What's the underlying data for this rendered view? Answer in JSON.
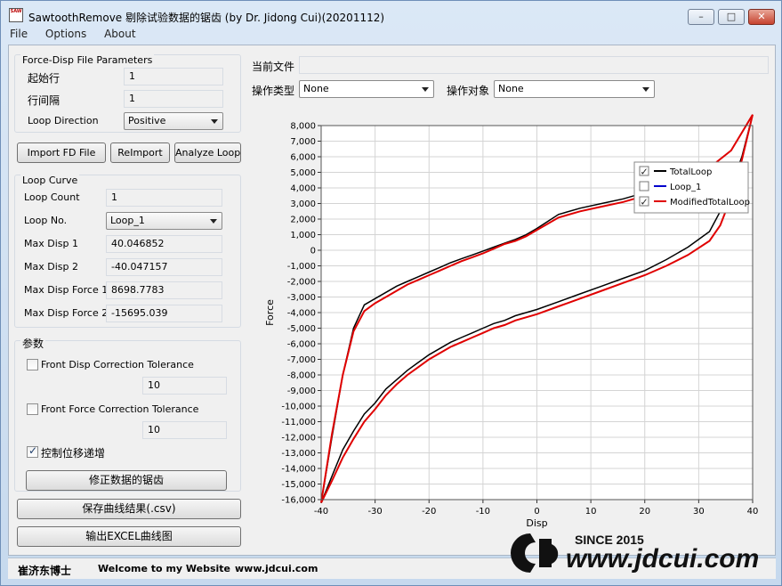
{
  "window": {
    "title": "SawtoothRemove 剔除试验数据的锯齿 (by Dr. Jidong Cui)(20201112)",
    "icon_text": "SAW",
    "minimize_glyph": "–",
    "maximize_glyph": "□",
    "close_glyph": "✕"
  },
  "menu": [
    "File",
    "Options",
    "About"
  ],
  "params": {
    "title": "Force-Disp File Parameters",
    "start_row_label": "起始行",
    "start_row_value": "1",
    "row_interval_label": "行间隔",
    "row_interval_value": "1",
    "loop_direction_label": "Loop Direction",
    "loop_direction_value": "Positive"
  },
  "buttons": {
    "import": "Import FD File",
    "reimport": "ReImport",
    "analyze": "Analyze Loop",
    "fix": "修正数据的锯齿",
    "save": "保存曲线结果(.csv)",
    "export": "输出EXCEL曲线图"
  },
  "loop_curve": {
    "title": "Loop Curve",
    "rows": [
      {
        "label": "Loop Count",
        "value": "1"
      },
      {
        "label": "Loop No.",
        "value": "Loop_1"
      },
      {
        "label": "Max Disp 1",
        "value": "40.046852"
      },
      {
        "label": "Max Disp 2",
        "value": "-40.047157"
      },
      {
        "label": "Max Disp Force 1",
        "value": "8698.7783"
      },
      {
        "label": "Max Disp Force 2",
        "value": "-15695.039"
      }
    ]
  },
  "settings": {
    "title": "参数",
    "front_disp_label": "Front Disp Correction Tolerance",
    "front_disp_value": "10",
    "front_force_label": "Front Force Correction Tolerance",
    "front_force_value": "10",
    "control_disp_label": "控制位移递增"
  },
  "file": {
    "current_file_label": "当前文件",
    "current_file_value": "",
    "op_type_label": "操作类型",
    "op_type_value": "None",
    "op_target_label": "操作对象",
    "op_target_value": "None"
  },
  "status": {
    "author": "崔济东博士",
    "welcome": "Welcome to my Website",
    "site": "www.jdcui.com"
  },
  "watermark": {
    "since": "SINCE 2015",
    "url": "www.jdcui.com"
  },
  "colors": {
    "total_loop": "#000000",
    "loop_1": "#0000cc",
    "modified": "#e00000"
  },
  "chart_data": {
    "type": "line",
    "xlabel": "Disp",
    "ylabel": "Force",
    "xlim": [
      -40,
      40
    ],
    "ylim": [
      -16000,
      8000
    ],
    "xticks": [
      -40,
      -30,
      -20,
      -10,
      0,
      10,
      20,
      30,
      40
    ],
    "yticks": [
      8000,
      7000,
      6000,
      5000,
      4000,
      3000,
      2000,
      1000,
      0,
      -1000,
      -2000,
      -3000,
      -4000,
      -5000,
      -6000,
      -7000,
      -8000,
      -9000,
      -10000,
      -11000,
      -12000,
      -13000,
      -14000,
      -15000,
      -16000
    ],
    "grid": true,
    "legend_position": "top-right",
    "series": [
      {
        "name": "TotalLoop",
        "checked": true,
        "x": [
          -40,
          -38,
          -36,
          -34,
          -32,
          -30,
          -28,
          -26,
          -24,
          -22,
          -20,
          -18,
          -16,
          -14,
          -12,
          -10,
          -8,
          -6,
          -4,
          -2,
          0,
          0,
          4,
          8,
          12,
          16,
          20,
          24,
          28,
          32,
          34,
          36,
          38,
          40,
          40,
          36,
          32,
          28,
          24,
          20,
          16,
          12,
          8,
          4,
          0,
          -2,
          -4,
          -6,
          -8,
          -10,
          -12,
          -14,
          -16,
          -18,
          -20,
          -22,
          -24,
          -26,
          -28,
          -30,
          -32,
          -34,
          -36,
          -38,
          -40
        ],
        "y": [
          -16200,
          -14500,
          -12800,
          -11600,
          -10500,
          -9800,
          -8900,
          -8300,
          -7700,
          -7200,
          -6700,
          -6300,
          -5900,
          -5600,
          -5300,
          -5000,
          -4700,
          -4500,
          -4200,
          -4000,
          -3800,
          -3800,
          -3300,
          -2800,
          -2300,
          -1800,
          -1300,
          -600,
          200,
          1200,
          2500,
          4100,
          6000,
          8700,
          8700,
          6400,
          5300,
          4600,
          4100,
          3700,
          3300,
          3000,
          2700,
          2300,
          1400,
          1000,
          700,
          450,
          200,
          -50,
          -300,
          -550,
          -800,
          -1100,
          -1400,
          -1700,
          -2000,
          -2300,
          -2700,
          -3100,
          -3500,
          -5000,
          -8000,
          -12000,
          -16200
        ]
      },
      {
        "name": "Loop_1",
        "checked": false,
        "x": [],
        "y": []
      },
      {
        "name": "ModifiedTotalLoop",
        "checked": true,
        "x": [
          -40,
          -38,
          -36,
          -34,
          -32,
          -30,
          -28,
          -26,
          -24,
          -22,
          -20,
          -18,
          -16,
          -14,
          -12,
          -10,
          -8,
          -6,
          -4,
          -2,
          0,
          4,
          8,
          12,
          16,
          20,
          24,
          28,
          32,
          34,
          36,
          38,
          40,
          40,
          36,
          32,
          28,
          24,
          20,
          16,
          12,
          8,
          4,
          0,
          -2,
          -4,
          -6,
          -8,
          -10,
          -12,
          -14,
          -16,
          -18,
          -20,
          -22,
          -24,
          -26,
          -28,
          -30,
          -32,
          -34,
          -36,
          -38,
          -40
        ],
        "y": [
          -16200,
          -14800,
          -13300,
          -12100,
          -11000,
          -10200,
          -9300,
          -8600,
          -8000,
          -7500,
          -7000,
          -6600,
          -6200,
          -5900,
          -5600,
          -5300,
          -5000,
          -4800,
          -4500,
          -4300,
          -4100,
          -3600,
          -3100,
          -2600,
          -2100,
          -1600,
          -1000,
          -300,
          600,
          1600,
          3400,
          5800,
          8700,
          8700,
          6400,
          5300,
          4500,
          4000,
          3500,
          3100,
          2800,
          2500,
          2100,
          1300,
          900,
          600,
          400,
          100,
          -200,
          -450,
          -700,
          -1000,
          -1300,
          -1600,
          -1900,
          -2200,
          -2600,
          -3000,
          -3400,
          -3900,
          -5200,
          -8000,
          -11800,
          -16200
        ]
      }
    ]
  }
}
